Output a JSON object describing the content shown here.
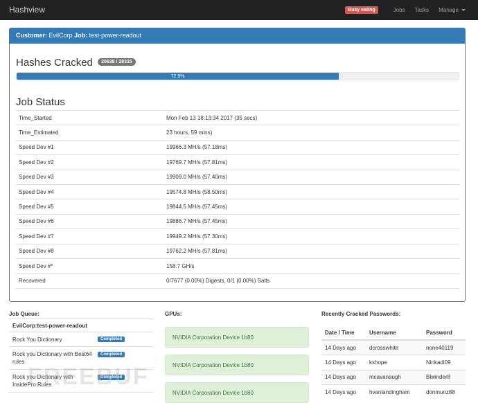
{
  "navbar": {
    "brand": "Hashview",
    "busy_badge": "Busy eating",
    "links": [
      "Jobs",
      "Tasks",
      "Manage"
    ]
  },
  "panel": {
    "customer_label": "Customer:",
    "customer_name": "EvilCorp",
    "job_label": "Job:",
    "job_name": "test-power-readout"
  },
  "hashes": {
    "title": "Hashes Cracked",
    "count": "20638 / 28315",
    "progress_label": "72.9%",
    "progress_percent": 72.9
  },
  "job_status": {
    "title": "Job Status",
    "rows": [
      {
        "key": "Time_Started",
        "value": "Mon Feb 13 18:13:34 2017 (35 secs)"
      },
      {
        "key": "Time_Estimated",
        "value": "23 hours, 59 mins)"
      },
      {
        "key": "Speed Dev #1",
        "value": "19966.3 MH/s (57.18ms)"
      },
      {
        "key": "Speed Dev #2",
        "value": "19769.7 MH/s (57.81ms)"
      },
      {
        "key": "Speed Dev #3",
        "value": "19909.0 MH/s (57.40ms)"
      },
      {
        "key": "Speed Dev #4",
        "value": "19574.8 MH/s (58.50ms)"
      },
      {
        "key": "Speed Dev #5",
        "value": "19844.5 MH/s (57.45ms)"
      },
      {
        "key": "Speed Dev #6",
        "value": "19886.7 MH/s (57.45ms)"
      },
      {
        "key": "Speed Dev #7",
        "value": "19949.2 MH/s (57.30ms)"
      },
      {
        "key": "Speed Dev #8",
        "value": "19762.2 MH/s (57.81ms)"
      },
      {
        "key": "Speed Dev #*",
        "value": "158.7 GH/s"
      },
      {
        "key": "Recovered",
        "value": "0/7677 (0.00%) Digests, 0/1 (0.00%) Salts"
      }
    ]
  },
  "job_queue": {
    "title": "Job Queue:",
    "job_name": "EvilCorp:test-power-readout",
    "items": [
      {
        "name": "Rock You Dictionary",
        "status": "Completed"
      },
      {
        "name": "Rock you Dictionary with Best64 rules",
        "status": "Completed"
      },
      {
        "name": "Rock you Dictionary with InsidePro Rules",
        "status": "Completed"
      }
    ]
  },
  "gpus": {
    "title": "GPUs:",
    "devices": [
      "NVIDIA Corporation Device 1b80",
      "NVIDIA Corporation Device 1b80",
      "NVIDIA Corporation Device 1b80"
    ]
  },
  "recently_cracked": {
    "title": "Recently Cracked Passwords:",
    "headers": [
      "Date / Time",
      "Username",
      "Password"
    ],
    "rows": [
      [
        "14 Days ago",
        "dcrosswhite",
        "none40119"
      ],
      [
        "14 Days ago",
        "kshope",
        "Ninkadi09"
      ],
      [
        "14 Days ago",
        "mcavanaugh",
        "Blwinder8"
      ],
      [
        "14 Days ago",
        "hvanlandingham",
        "donmunz88"
      ]
    ]
  },
  "watermark": "FREEBUF",
  "colors": {
    "navbar": "#222222",
    "primary": "#337ab7",
    "danger": "#d9534f",
    "success_bg": "#dff0d8",
    "success_text": "#3c763d"
  }
}
